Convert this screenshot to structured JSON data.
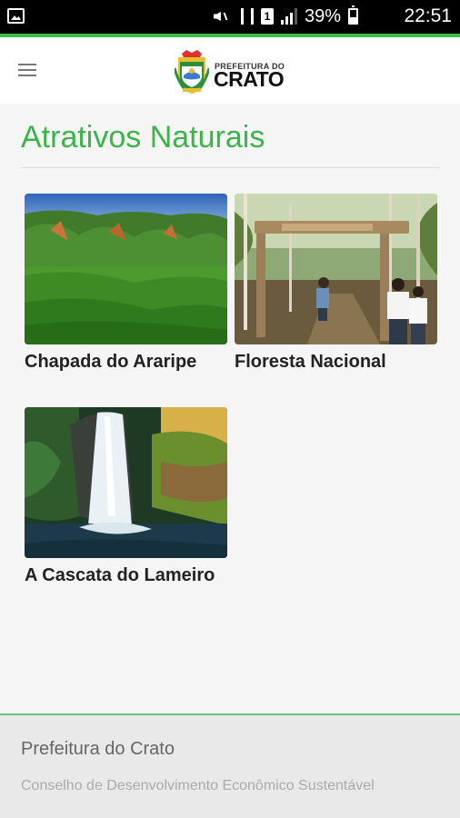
{
  "status_bar": {
    "battery_percent": "39%",
    "time": "22:51",
    "sim_label": "1"
  },
  "header": {
    "logo_small": "PREFEITURA DO",
    "logo_big": "CRATO"
  },
  "page": {
    "title": "Atrativos Naturais"
  },
  "cards": [
    {
      "label": "Chapada do Araripe"
    },
    {
      "label": "Floresta Nacional"
    },
    {
      "label": "A Cascata do Lameiro"
    }
  ],
  "footer": {
    "title": "Prefeitura do Crato",
    "subtitle": "Conselho de Desenvolvimento Econômico Sustentável"
  },
  "colors": {
    "accent_green": "#3bb54a",
    "status_bar": "#000000"
  }
}
